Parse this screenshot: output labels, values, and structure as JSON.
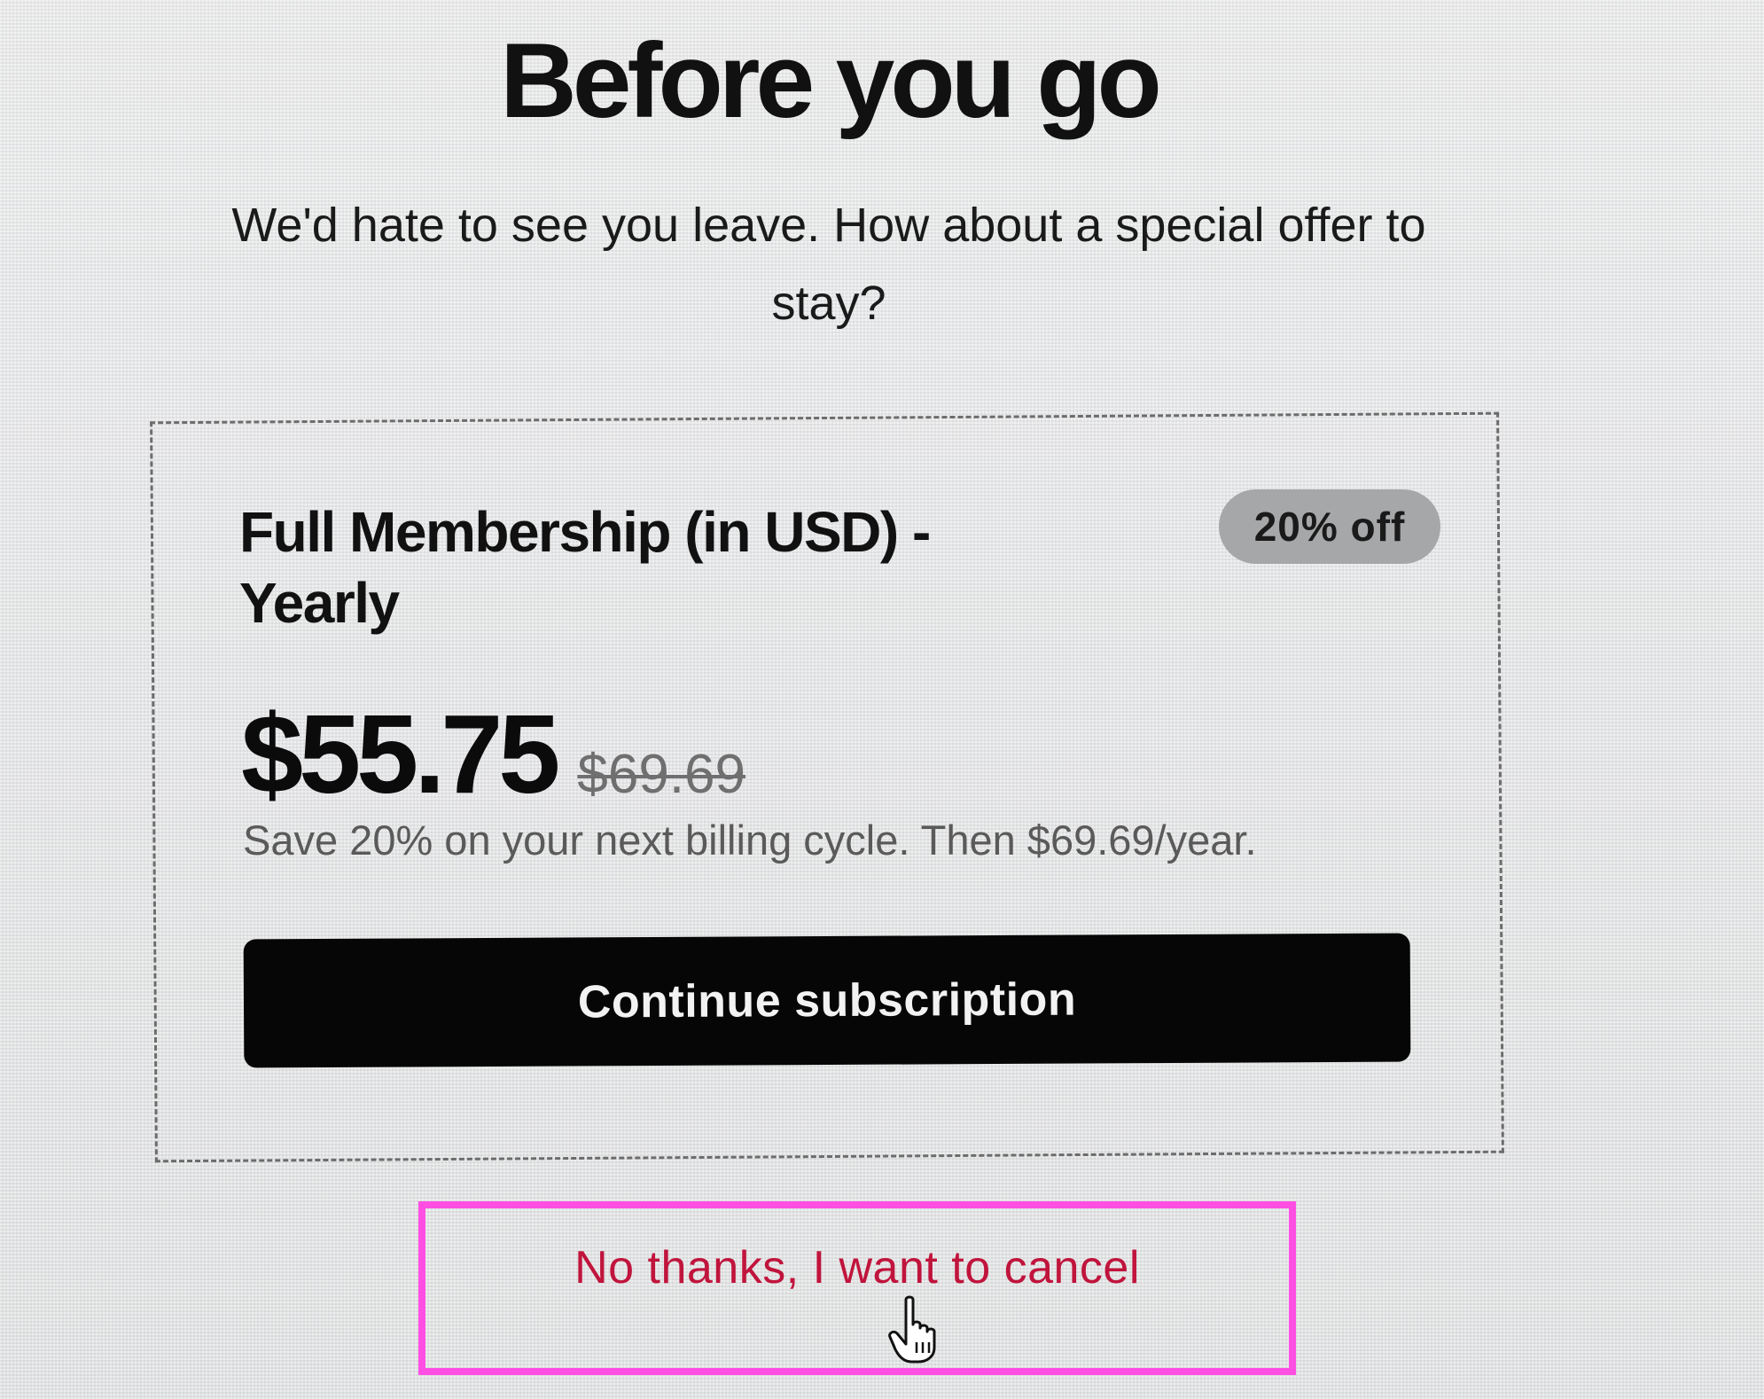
{
  "header": {
    "title": "Before you go",
    "subtitle": "We'd hate to see you leave. How about a special offer to stay?"
  },
  "offer": {
    "plan_name": "Full Membership (in USD) - Yearly",
    "badge": "20% off",
    "price_current": "$55.75",
    "price_original": "$69.69",
    "note": "Save 20% on your next billing cycle. Then $69.69/year.",
    "continue_label": "Continue subscription"
  },
  "cancel": {
    "label": "No thanks, I want to cancel"
  },
  "colors": {
    "button_bg": "#060606",
    "cancel_text": "#c0143c",
    "highlight_border": "#ff4fe3",
    "badge_bg": "#a6a7a8"
  },
  "icons": {
    "cursor": "hand-pointer-icon"
  }
}
